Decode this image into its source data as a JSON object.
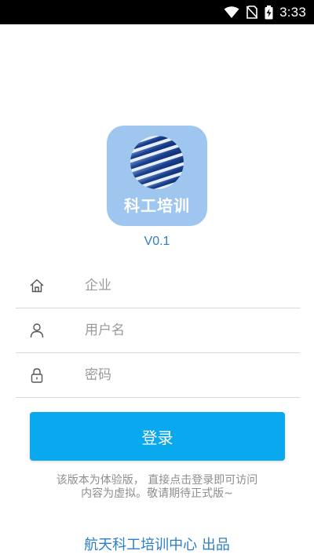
{
  "status_bar": {
    "time": "3:33",
    "icons": [
      "wifi-icon",
      "no-sim-icon",
      "battery-charging-icon"
    ]
  },
  "app": {
    "logo_text": "科工培训",
    "version": "V0.1"
  },
  "form": {
    "company": {
      "icon": "home-icon",
      "placeholder": "企业",
      "value": ""
    },
    "username": {
      "icon": "user-icon",
      "placeholder": "用户名",
      "value": ""
    },
    "password": {
      "icon": "lock-icon",
      "placeholder": "密码",
      "value": ""
    },
    "login_label": "登录"
  },
  "notice": {
    "line1": "该版本为体验版， 直接点击登录即可访问",
    "line2": "内容为虚拟。敬请期待正式版~"
  },
  "footer": "航天科工培训中心 出品",
  "colors": {
    "primary": "#0aa8ef",
    "accent_text": "#2b7ec7",
    "logo_bg": "#9ec6ee"
  }
}
